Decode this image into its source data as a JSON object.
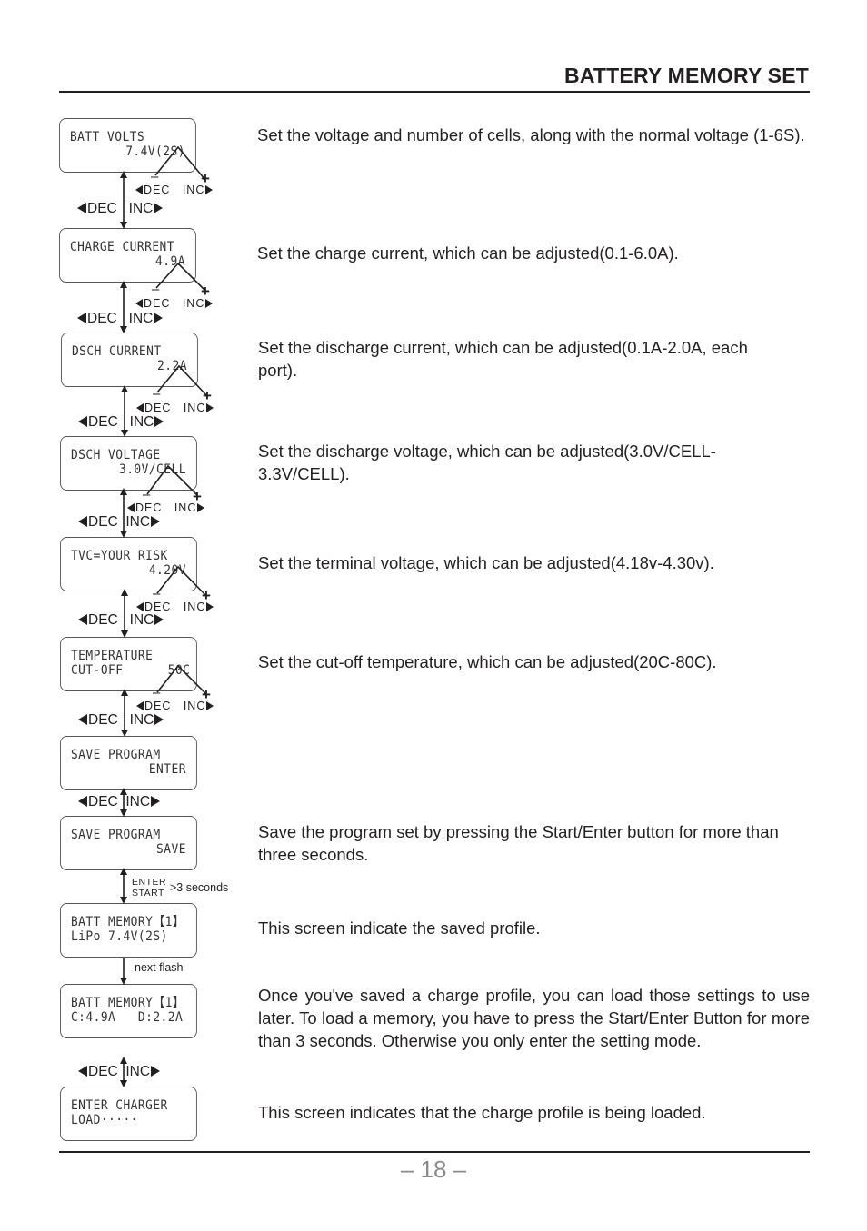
{
  "header": {
    "title": "BATTERY MEMORY SET"
  },
  "nav": {
    "dec": "DEC",
    "inc": "INC",
    "minus": "–",
    "plus": "+"
  },
  "screens": [
    {
      "line1": "BATT VOLTS",
      "line2": "7.4V(2S)",
      "description": "Set the voltage and number of cells, along with the normal voltage (1-6S)."
    },
    {
      "line1": "CHARGE CURRENT",
      "line2": "4.9A",
      "description": "Set the charge current, which can be adjusted(0.1-6.0A)."
    },
    {
      "line1": "DSCH CURRENT",
      "line2": "2.2A",
      "description": "Set the discharge current, which can be adjusted(0.1A-2.0A, each port)."
    },
    {
      "line1": "DSCH VOLTAGE",
      "line2": "3.0V/CELL",
      "description": "Set the discharge voltage, which can be adjusted(3.0V/CELL-3.3V/CELL)."
    },
    {
      "line1": "TVC=YOUR RISK",
      "line2": "4.20V",
      "description": "Set the terminal voltage, which can be adjusted(4.18v-4.30v)."
    },
    {
      "line1": "TEMPERATURE",
      "line2": "CUT-OFF      50C",
      "description": "Set the cut-off temperature, which can be adjusted(20C-80C)."
    },
    {
      "line1": "SAVE PROGRAM",
      "line2": "ENTER",
      "description": ""
    },
    {
      "line1": "SAVE PROGRAM",
      "line2": "SAVE",
      "description": "Save the program set by pressing the Start/Enter button for more than three seconds."
    },
    {
      "line1": "BATT MEMORY【1】",
      "line2": "LiPo 7.4V(2S)",
      "description": "This screen indicate the saved profile."
    },
    {
      "line1": "BATT MEMORY【1】",
      "line2": "C:4.9A   D:2.2A",
      "description": "Once you've saved a charge profile, you can load those settings to use later. To load a memory, you have to press the Start/Enter Button for more than 3 seconds. Otherwise you only enter the setting mode."
    },
    {
      "line1": "ENTER CHARGER",
      "line2": "LOAD·····",
      "description": "This screen indicates that the charge profile is being loaded."
    }
  ],
  "transitions": {
    "enter": "ENTER",
    "start": "START",
    "hold": ">3 seconds",
    "next_flash": "next flash"
  },
  "footer": {
    "page_number": "– 18 –"
  }
}
